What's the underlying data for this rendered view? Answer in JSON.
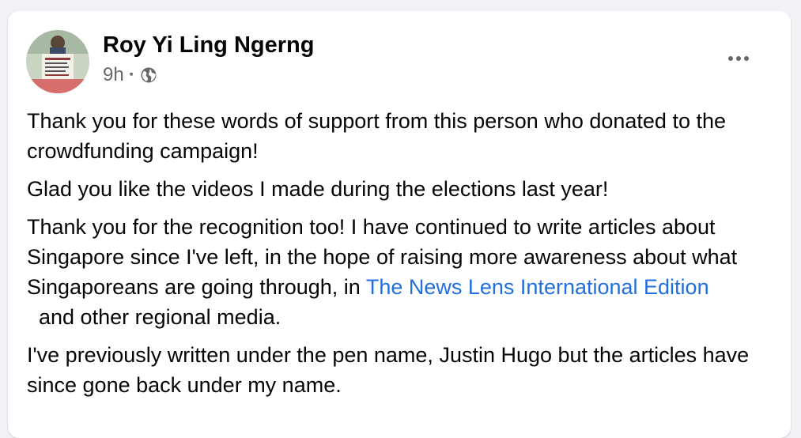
{
  "post": {
    "author": "Roy Yi Ling Ngerng",
    "time": "9h",
    "separator": "·",
    "privacy_icon": "globe-icon",
    "more_icon": "more-horizontal-icon",
    "paragraphs": {
      "p1": "Thank you for these words of support from this person who donated to the crowdfunding campaign!",
      "p2": "Glad you like the videos I made during the elections last year!",
      "p3_before": "Thank you for the recognition too! I have continued to write articles about Singapore since I've left, in the hope of raising more awareness about what Singaporeans are going through, in ",
      "p3_link": "The News Lens International Edition",
      "p3_after": "  and other regional media.",
      "p4": "I've previously written under the pen name, Justin Hugo but the articles have since gone back under my name."
    }
  },
  "colors": {
    "background": "#f0f2f5",
    "card": "#ffffff",
    "text": "#050505",
    "secondary_text": "#65676b",
    "link": "#216fdb"
  }
}
